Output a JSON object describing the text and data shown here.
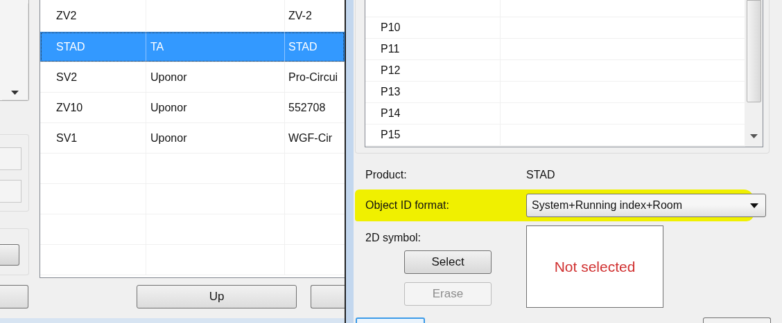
{
  "left_table": {
    "rows": [
      {
        "column_1": "ZV2",
        "column_3": "ZV-2",
        "selected": false
      },
      {
        "column_1": "STAD",
        "column_2": "TA",
        "column_3": "STAD",
        "selected": true
      },
      {
        "column_1": "SV2",
        "column_2": "Uponor",
        "column_3": "Pro-Circui",
        "selected": false
      },
      {
        "column_1": "ZV10",
        "column_2": "Uponor",
        "column_3": "552708",
        "selected": false
      },
      {
        "column_1": "SV1",
        "column_2": "Uponor",
        "column_3": "WGF-Cir",
        "selected": false
      }
    ]
  },
  "left_buttons": [
    "Up"
  ],
  "dialog": {
    "list_rows": [
      {
        "column_1": "P10"
      },
      {
        "column_1": "P11"
      },
      {
        "column_1": "P12"
      },
      {
        "column_1": "P13"
      },
      {
        "column_1": "P14"
      },
      {
        "column_1": "P15"
      }
    ],
    "product": {
      "label": "Product:",
      "value": "STAD"
    },
    "object_id_format": {
      "label": "Object ID format:",
      "value": "System+Running index+Room",
      "highlighted": true
    },
    "symbol": {
      "label": "2D symbol:",
      "preview": "Not selected"
    },
    "buttons": [
      {
        "label": "Select",
        "disabled": false
      },
      {
        "label": "Erase",
        "disabled": true
      }
    ]
  }
}
